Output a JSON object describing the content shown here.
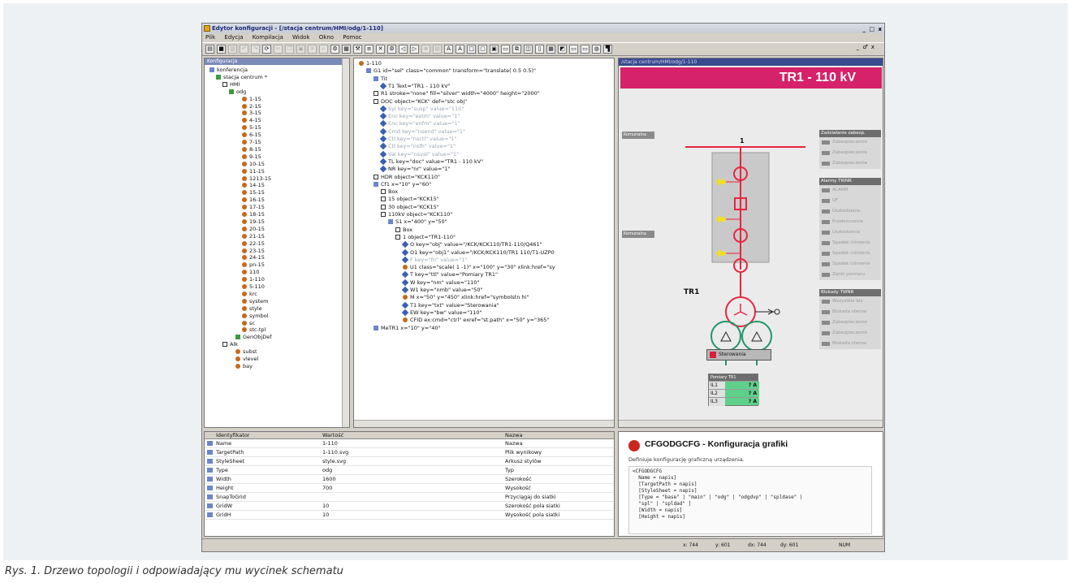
{
  "window": {
    "title": "Edytor konfiguracji - [/stacja centrum/HMI/odg/1-110]",
    "controls": "_ □ x",
    "controls2": "_ ♂ x"
  },
  "menu": [
    "Plik",
    "Edycja",
    "Kompilacja",
    "Widok",
    "Okno",
    "Pomoc"
  ],
  "tree": {
    "header": "Konfiguracja",
    "items": [
      {
        "label": "konferencja",
        "indent": 0,
        "icon": "pc"
      },
      {
        "label": "stacja centrum *",
        "indent": 1,
        "icon": "net"
      },
      {
        "label": "HMI",
        "indent": 2,
        "icon": "fold"
      },
      {
        "label": "odg",
        "indent": 3,
        "icon": "net"
      },
      {
        "label": "1-15",
        "indent": 5,
        "icon": "comp"
      },
      {
        "label": "2-15",
        "indent": 5,
        "icon": "comp"
      },
      {
        "label": "3-15",
        "indent": 5,
        "icon": "comp"
      },
      {
        "label": "4-15",
        "indent": 5,
        "icon": "comp"
      },
      {
        "label": "5-15",
        "indent": 5,
        "icon": "comp"
      },
      {
        "label": "6-15",
        "indent": 5,
        "icon": "comp"
      },
      {
        "label": "7-15",
        "indent": 5,
        "icon": "comp"
      },
      {
        "label": "8-15",
        "indent": 5,
        "icon": "comp"
      },
      {
        "label": "9-15",
        "indent": 5,
        "icon": "comp"
      },
      {
        "label": "10-15",
        "indent": 5,
        "icon": "comp"
      },
      {
        "label": "11-15",
        "indent": 5,
        "icon": "comp"
      },
      {
        "label": "1213-15",
        "indent": 5,
        "icon": "comp"
      },
      {
        "label": "14-15",
        "indent": 5,
        "icon": "comp"
      },
      {
        "label": "15-15",
        "indent": 5,
        "icon": "comp"
      },
      {
        "label": "16-15",
        "indent": 5,
        "icon": "comp"
      },
      {
        "label": "17-15",
        "indent": 5,
        "icon": "comp"
      },
      {
        "label": "18-15",
        "indent": 5,
        "icon": "comp"
      },
      {
        "label": "19-15",
        "indent": 5,
        "icon": "comp"
      },
      {
        "label": "20-15",
        "indent": 5,
        "icon": "comp"
      },
      {
        "label": "21-15",
        "indent": 5,
        "icon": "comp"
      },
      {
        "label": "22-15",
        "indent": 5,
        "icon": "comp"
      },
      {
        "label": "23-15",
        "indent": 5,
        "icon": "comp"
      },
      {
        "label": "24-15",
        "indent": 5,
        "icon": "comp"
      },
      {
        "label": "pn-15",
        "indent": 5,
        "icon": "comp"
      },
      {
        "label": "110",
        "indent": 5,
        "icon": "comp"
      },
      {
        "label": "1-110",
        "indent": 5,
        "icon": "comp"
      },
      {
        "label": "5-110",
        "indent": 5,
        "icon": "comp"
      },
      {
        "label": "krc",
        "indent": 5,
        "icon": "comp"
      },
      {
        "label": "system",
        "indent": 5,
        "icon": "comp"
      },
      {
        "label": "style",
        "indent": 5,
        "icon": "comp"
      },
      {
        "label": "symbol",
        "indent": 5,
        "icon": "comp"
      },
      {
        "label": "sc",
        "indent": 5,
        "icon": "comp"
      },
      {
        "label": "stc-tpl",
        "indent": 5,
        "icon": "comp"
      },
      {
        "label": "GenObjDef",
        "indent": 4,
        "icon": "net"
      },
      {
        "label": "Alk",
        "indent": 2,
        "icon": "fold"
      },
      {
        "label": "subst",
        "indent": 4,
        "icon": "comp"
      },
      {
        "label": "vlevel",
        "indent": 4,
        "icon": "comp"
      },
      {
        "label": "bay",
        "indent": 4,
        "icon": "comp"
      }
    ]
  },
  "xml": {
    "lines": [
      {
        "text": "1-110",
        "indent": 0,
        "icon": "comp",
        "faded": false
      },
      {
        "text": "G1  id=\"sel\"  class=\"common\"  transform=\"translate( 0.5 0.5)\"",
        "indent": 1,
        "icon": "pc",
        "faded": false
      },
      {
        "text": "Tit",
        "indent": 2,
        "icon": "pc",
        "faded": false
      },
      {
        "text": "T1  Text=\"TR1 - 110 kV\"",
        "indent": 3,
        "icon": "diam",
        "faded": false
      },
      {
        "text": "R1  stroke=\"none\"  fill=\"silver\"  width=\"4000\"  height=\"2000\"",
        "indent": 2,
        "icon": "fold",
        "faded": false
      },
      {
        "text": "DOC  object=\"KCK\"  def=\"stc obj\"",
        "indent": 2,
        "icon": "fold",
        "faded": false
      },
      {
        "text": "Syl  key=\"susp\"  value=\"110\"",
        "indent": 3,
        "icon": "diam",
        "faded": true
      },
      {
        "text": "Enc  key=\"estm\"  value=\"1\"",
        "indent": 3,
        "icon": "diam",
        "faded": true
      },
      {
        "text": "Enc  key=\"enfm\"  value=\"1\"",
        "indent": 3,
        "icon": "diam",
        "faded": true
      },
      {
        "text": "Cmd  key=\"nsend\"  value=\"1\"",
        "indent": 3,
        "icon": "diam",
        "faded": true
      },
      {
        "text": "Ctl  key=\"nsctl\"  value=\"1\"",
        "indent": 3,
        "icon": "diam",
        "faded": true
      },
      {
        "text": "Ctl  key=\"nsfh\"  value=\"1\"",
        "indent": 3,
        "icon": "diam",
        "faded": true
      },
      {
        "text": "Val  key=\"nsval\"  value=\"1\"",
        "indent": 3,
        "icon": "diam",
        "faded": true
      },
      {
        "text": "TL  key=\"doc\"  value=\"TR1 - 110 kV\"",
        "indent": 3,
        "icon": "diam",
        "faded": false
      },
      {
        "text": "NR  key=\"nr\"  value=\"1\"",
        "indent": 3,
        "icon": "diam",
        "faded": false
      },
      {
        "text": "HDR  object=\"KCK110\"",
        "indent": 2,
        "icon": "fold",
        "faded": false
      },
      {
        "text": "Cf1  x=\"10\"  y=\"60\"",
        "indent": 2,
        "icon": "pc",
        "faded": false
      },
      {
        "text": "Box",
        "indent": 3,
        "icon": "fold",
        "faded": false
      },
      {
        "text": "15  object=\"KCK15\"",
        "indent": 3,
        "icon": "fold",
        "faded": false
      },
      {
        "text": "30  object=\"KCK15\"",
        "indent": 3,
        "icon": "fold",
        "faded": false
      },
      {
        "text": "110kV  object=\"KCK110\"",
        "indent": 3,
        "icon": "fold",
        "faded": false
      },
      {
        "text": "S1  x=\"400\"  y=\"50\"",
        "indent": 4,
        "icon": "pc",
        "faded": false
      },
      {
        "text": "Box",
        "indent": 5,
        "icon": "fold",
        "faded": false
      },
      {
        "text": "1  object=\"TR1-110\"",
        "indent": 5,
        "icon": "fold",
        "faded": false
      },
      {
        "text": "O  key=\"obj\"  value=\"/KCK/KCK110/TR1-110/Q461\"",
        "indent": 6,
        "icon": "diam",
        "faded": false
      },
      {
        "text": "O1  key=\"obj1\"  value=\"/KCK/KCK110/TR1 110/T1-UZP0",
        "indent": 6,
        "icon": "diam",
        "faded": false
      },
      {
        "text": "F  key=\"fn\"  value=\"1\"",
        "indent": 6,
        "icon": "diam",
        "faded": true
      },
      {
        "text": "U1  class=\"scale( 1 -1)\"  x=\"100\"  y=\"30\"  xlink:href=\"sy",
        "indent": 6,
        "icon": "comp",
        "faded": false
      },
      {
        "text": "T  key=\"ttl\"  value=\"Pomiary TR1\"",
        "indent": 6,
        "icon": "diam",
        "faded": false
      },
      {
        "text": "W  key=\"nm\"  value=\"110\"",
        "indent": 6,
        "icon": "diam",
        "faded": false
      },
      {
        "text": "W1  key=\"nmb\"  value=\"50\"",
        "indent": 6,
        "icon": "diam",
        "faded": false
      },
      {
        "text": "M  x=\"50\"  y=\"450\"  xlink:href=\"symbolstn hi\"",
        "indent": 6,
        "icon": "comp",
        "faded": false
      },
      {
        "text": "T1  key=\"txt\"  value=\"Sterowania\"",
        "indent": 6,
        "icon": "diam",
        "faded": false
      },
      {
        "text": "EW  key=\"bw\"  value=\"110\"",
        "indent": 6,
        "icon": "diam",
        "faded": false
      },
      {
        "text": "CFID  ex:cmd=\"ctrl\"  exref=\"st.path\"  x=\"50\"  y=\"365\"",
        "indent": 6,
        "icon": "comp",
        "faded": false
      },
      {
        "text": "MeTR1  x=\"10\"  y=\"40\"",
        "indent": 2,
        "icon": "pc",
        "faded": false
      }
    ]
  },
  "preview": {
    "tab": "/stacja centrum/HMI/odg/1-110",
    "banner": "TR1 - 110 kV",
    "left_buttons": [
      "Komunalna",
      "Komunalna"
    ],
    "bay_label": "1",
    "transformer_label": "TR1",
    "groups": [
      {
        "head": "Zadziałanie zabezp.",
        "items": [
          "Zabezpieczenie",
          "Zabezpieczenie",
          "Zabezpieczenie"
        ]
      },
      {
        "head": "Alarmy TWNR",
        "items": [
          "ALARM",
          "UF",
          "Uszkodzenie",
          "Przekroczenie",
          "Uszkodzenie",
          "Spadek ciśnienia",
          "Spadek ciśnienia",
          "Spadek ciśnienia",
          "Zanik pomiaru"
        ]
      },
      {
        "head": "Blokady TWNR",
        "items": [
          "Wszystkie blo",
          "Blokada sterow",
          "Zabezpieczenie",
          "Zabezpieczenie",
          "Blokada sterow"
        ]
      }
    ],
    "control_button": "Sterowania",
    "meas": {
      "title": "Pomiary TR1",
      "rows": [
        {
          "label": "IL1",
          "value": "? A"
        },
        {
          "label": "IL2",
          "value": "? A"
        },
        {
          "label": "IL3",
          "value": "? A"
        }
      ]
    }
  },
  "properties": {
    "headers": [
      "Identyfikator",
      "Wartość",
      "Nazwa"
    ],
    "rows": [
      {
        "id": "Name",
        "value": "1-110",
        "name": "Nazwa"
      },
      {
        "id": "TargetPath",
        "value": "1-110.svg",
        "name": "Plik wynikowy"
      },
      {
        "id": "StyleSheet",
        "value": "style.svg",
        "name": "Arkusz stylów"
      },
      {
        "id": "Type",
        "value": "odg",
        "name": "Typ"
      },
      {
        "id": "Width",
        "value": "1600",
        "name": "Szerokość"
      },
      {
        "id": "Height",
        "value": "700",
        "name": "Wysokość"
      },
      {
        "id": "SnapToGrid",
        "value": "",
        "name": "Przyciągaj do siatki"
      },
      {
        "id": "GridW",
        "value": "10",
        "name": "Szerokość pola siatki"
      },
      {
        "id": "GridH",
        "value": "10",
        "name": "Wysokość pola siatki"
      }
    ]
  },
  "help": {
    "title": "CFGODGCFG - Konfiguracja grafiki",
    "desc": "Definiuje konfigurację graficzną urządzenia.",
    "code": "<CFGODGCFG\n  Name = napis]\n  [TargetPath = napis]\n  [StyleSheet = napis]\n  [Type = \"base\" | \"main\" | \"odg\" | \"odgdvp\" | \"spldase\" |\n  \"spl\" | \"spldad\" ]\n  [Width = napis]\n  [Height = napis]"
  },
  "status": {
    "x": "x: 744",
    "y": "y: 601",
    "dx": "dx: 744",
    "dy": "dy: 601",
    "num": "NUM"
  },
  "caption": "Rys. 1. Drzewo topologii  i odpowiadający mu wycinek schematu",
  "colors": {
    "banner": "#d6226b",
    "circuit_red": "#e8253f",
    "circuit_green": "#22956a",
    "meas_green": "#5ed08a"
  }
}
